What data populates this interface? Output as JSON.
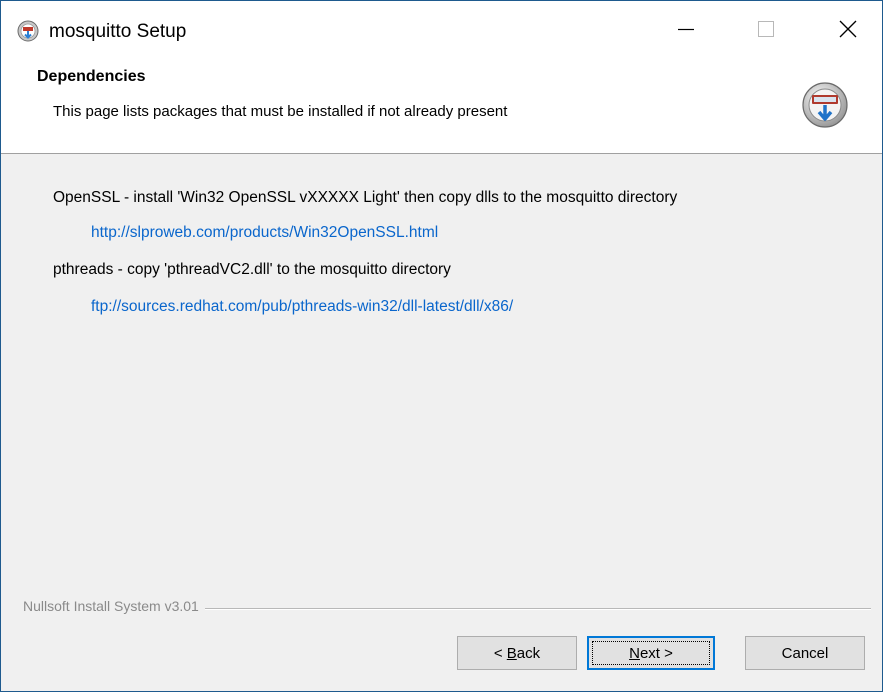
{
  "window": {
    "title": "mosquitto Setup",
    "controls": {
      "minimize": "minimize-icon",
      "maximize": "maximize-icon",
      "close": "close-icon"
    }
  },
  "header": {
    "title": "Dependencies",
    "subtitle": "This page lists packages that must be installed if not already present"
  },
  "content": {
    "items": [
      {
        "text": "OpenSSL - install 'Win32 OpenSSL vXXXXX Light' then copy dlls to the mosquitto directory",
        "link": "http://slproweb.com/products/Win32OpenSSL.html"
      },
      {
        "text": "pthreads - copy 'pthreadVC2.dll' to the mosquitto directory",
        "link": "ftp://sources.redhat.com/pub/pthreads-win32/dll-latest/dll/x86/"
      }
    ]
  },
  "branding": "Nullsoft Install System v3.01",
  "buttons": {
    "back": {
      "prefix": "< ",
      "accel": "B",
      "rest": "ack"
    },
    "next": {
      "accel": "N",
      "rest": "ext >"
    },
    "cancel": "Cancel"
  },
  "colors": {
    "link": "#0a66cc",
    "focus": "#0078d7",
    "border": "#1e5a8e"
  }
}
